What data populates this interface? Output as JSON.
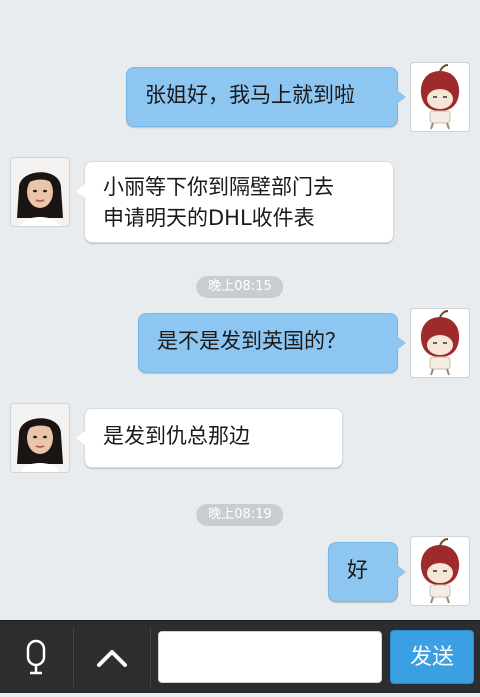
{
  "messages": [
    {
      "from": "self",
      "text": "张姐好，我马上就到啦"
    },
    {
      "from": "other",
      "lines": [
        "小丽等下你到隔壁部门去",
        "申请明天的DHL收件表"
      ]
    },
    {
      "from": "self",
      "text": "是不是发到英国的？"
    },
    {
      "from": "other",
      "text": "是发到仇总那边"
    },
    {
      "from": "self",
      "text": "好"
    }
  ],
  "timestamps": [
    "晚上08:15",
    "晚上08:19"
  ],
  "input": {
    "value": ""
  },
  "send_label": "发送",
  "colors": {
    "outgoing_bubble": "#8dc6f0",
    "incoming_bubble": "#ffffff",
    "send_button": "#3a9fe3"
  }
}
